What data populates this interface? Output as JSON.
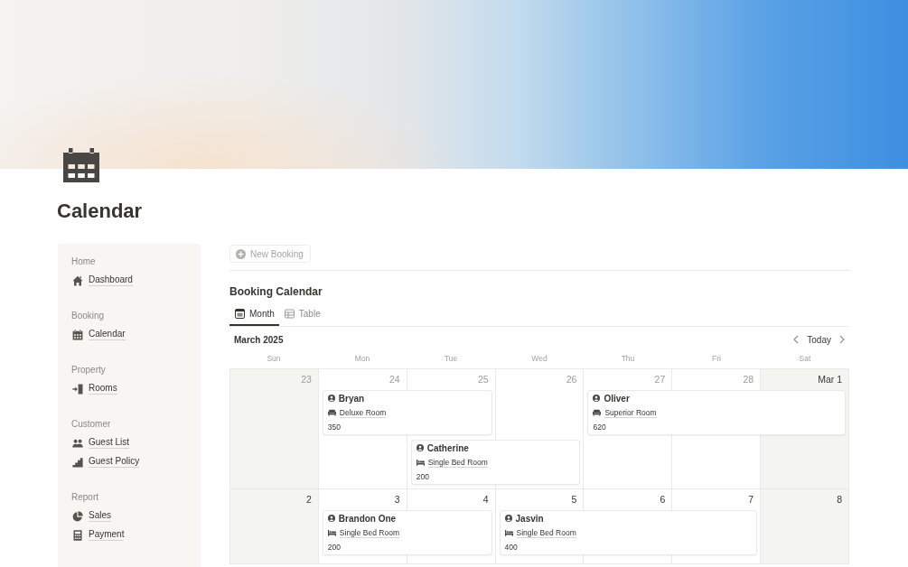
{
  "page": {
    "title": "Calendar"
  },
  "sidebar": {
    "groups": [
      {
        "label": "Home",
        "items": [
          {
            "label": "Dashboard",
            "kind": "dashboard"
          }
        ]
      },
      {
        "label": "Booking",
        "items": [
          {
            "label": "Calendar",
            "kind": "calendar"
          }
        ]
      },
      {
        "label": "Property",
        "items": [
          {
            "label": "Rooms",
            "kind": "rooms"
          }
        ]
      },
      {
        "label": "Customer",
        "items": [
          {
            "label": "Guest List",
            "kind": "guests"
          },
          {
            "label": "Guest Policy",
            "kind": "policy"
          }
        ]
      },
      {
        "label": "Report",
        "items": [
          {
            "label": "Sales",
            "kind": "sales"
          },
          {
            "label": "Payment",
            "kind": "payment"
          }
        ]
      }
    ]
  },
  "toolbar": {
    "new_button": "New Booking"
  },
  "calendar": {
    "title": "Booking Calendar",
    "tabs": [
      {
        "label": "Month",
        "kind": "calendar",
        "selected": true
      },
      {
        "label": "Table",
        "kind": "table",
        "selected": false
      }
    ],
    "month": "March 2025",
    "today": "Today",
    "weekdays": [
      "Sun",
      "Mon",
      "Tue",
      "Wed",
      "Thu",
      "Fri",
      "Sat"
    ],
    "weeks": [
      {
        "days": [
          {
            "date": "23",
            "in_month": false,
            "weekend": true
          },
          {
            "date": "24",
            "in_month": false,
            "weekend": false
          },
          {
            "date": "25",
            "in_month": false,
            "weekend": false
          },
          {
            "date": "26",
            "in_month": false,
            "weekend": false
          },
          {
            "date": "27",
            "in_month": false,
            "weekend": false
          },
          {
            "date": "28",
            "in_month": false,
            "weekend": false
          },
          {
            "date": "Mar 1",
            "in_month": true,
            "weekend": true
          }
        ],
        "lanes": [
          {
            "slots": [
              {
                "kind": "empty"
              },
              {
                "kind": "booking",
                "guest": "Bryan",
                "room": {
                  "label": "Deluxe Room",
                  "kind": "suite"
                },
                "price": "350"
              },
              {
                "kind": "continued"
              },
              {
                "kind": "empty"
              },
              {
                "kind": "booking",
                "guest": "Oliver",
                "room": {
                  "label": "Superior Room",
                  "kind": "suite"
                },
                "price": "620"
              },
              {
                "kind": "continued"
              },
              {
                "kind": "continued"
              }
            ]
          },
          {
            "slots": [
              {
                "kind": "empty"
              },
              {
                "kind": "empty"
              },
              {
                "kind": "booking",
                "guest": "Catherine",
                "room": {
                  "label": "Single Bed Room",
                  "kind": "single"
                },
                "price": "200"
              },
              {
                "kind": "continued"
              }
            ]
          }
        ]
      },
      {
        "days": [
          {
            "date": "2",
            "in_month": true,
            "weekend": true
          },
          {
            "date": "3",
            "in_month": true,
            "weekend": false
          },
          {
            "date": "4",
            "in_month": true,
            "weekend": false
          },
          {
            "date": "5",
            "in_month": true,
            "weekend": false
          },
          {
            "date": "6",
            "in_month": true,
            "weekend": false
          },
          {
            "date": "7",
            "in_month": true,
            "weekend": false
          },
          {
            "date": "8",
            "in_month": true,
            "weekend": true
          }
        ],
        "lanes": [
          {
            "slots": [
              {
                "kind": "empty"
              },
              {
                "kind": "booking",
                "guest": "Brandon One",
                "room": {
                  "label": "Single Bed Room",
                  "kind": "single"
                },
                "price": "200"
              },
              {
                "kind": "continued"
              },
              {
                "kind": "booking",
                "guest": "Jasvin",
                "room": {
                  "label": "Single Bed Room",
                  "kind": "single"
                },
                "price": "400"
              },
              {
                "kind": "continued"
              },
              {
                "kind": "continued"
              }
            ]
          }
        ]
      }
    ]
  }
}
